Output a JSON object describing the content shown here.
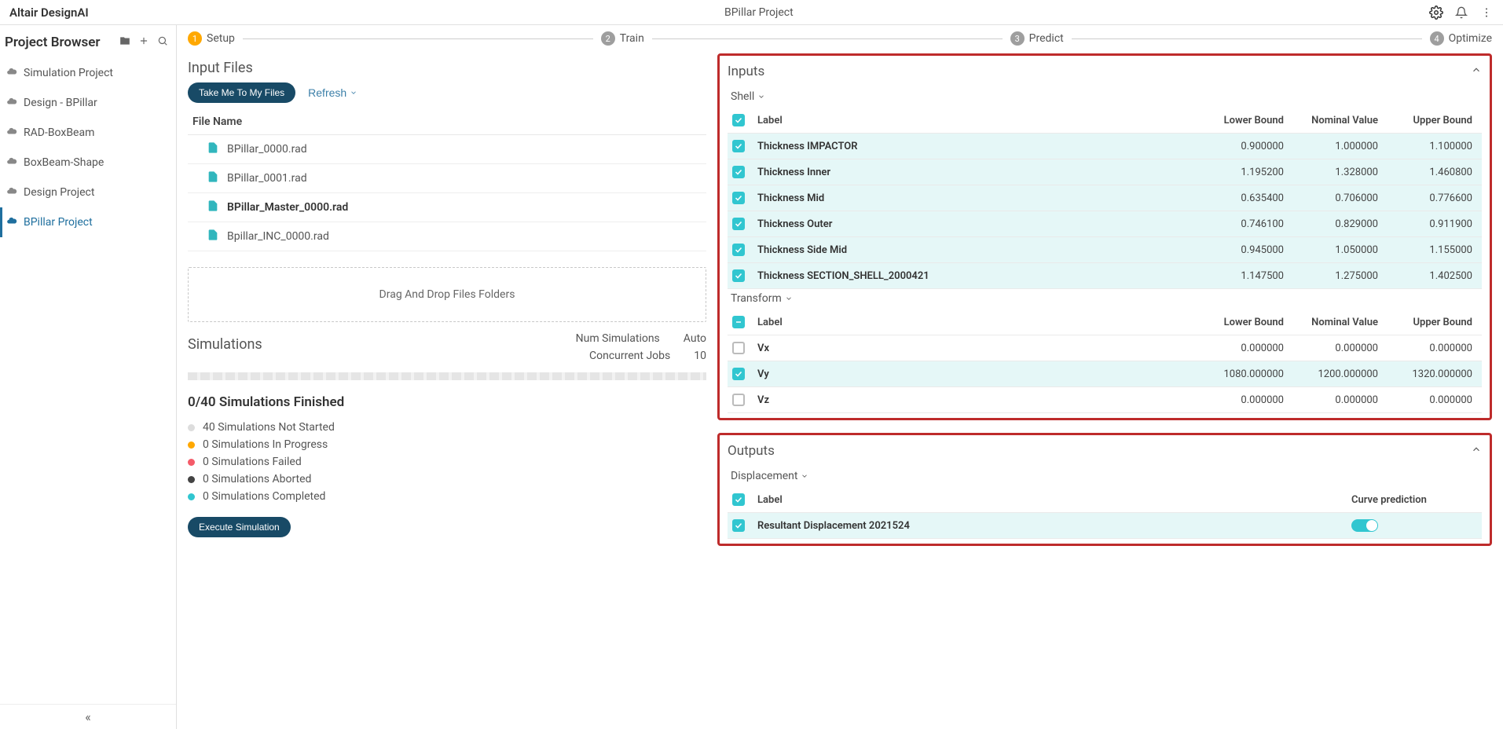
{
  "header": {
    "brand": "Altair DesignAI",
    "project": "BPillar Project"
  },
  "sidebar": {
    "title": "Project Browser",
    "items": [
      {
        "label": "Simulation Project",
        "active": false
      },
      {
        "label": "Design - BPillar",
        "active": false
      },
      {
        "label": "RAD-BoxBeam",
        "active": false
      },
      {
        "label": "BoxBeam-Shape",
        "active": false
      },
      {
        "label": "Design Project",
        "active": false
      },
      {
        "label": "BPillar Project",
        "active": true
      }
    ]
  },
  "stepper": {
    "steps": [
      {
        "num": "1",
        "label": "Setup",
        "active": true
      },
      {
        "num": "2",
        "label": "Train",
        "active": false
      },
      {
        "num": "3",
        "label": "Predict",
        "active": false
      },
      {
        "num": "4",
        "label": "Optimize",
        "active": false
      }
    ]
  },
  "inputFiles": {
    "title": "Input Files",
    "takeMe": "Take Me To My Files",
    "refresh": "Refresh",
    "colHeader": "File Name",
    "files": [
      {
        "name": "BPillar_0000.rad",
        "master": false
      },
      {
        "name": "BPillar_0001.rad",
        "master": false
      },
      {
        "name": "BPillar_Master_0000.rad",
        "master": true
      },
      {
        "name": "Bpillar_INC_0000.rad",
        "master": false
      }
    ],
    "dropzone": "Drag And Drop Files Folders"
  },
  "simulations": {
    "title": "Simulations",
    "numLabel": "Num Simulations",
    "numValue": "Auto",
    "concurrentLabel": "Concurrent Jobs",
    "concurrentValue": "10",
    "status": "0/40 Simulations Finished",
    "legend": [
      {
        "color": "grey",
        "text": "40 Simulations Not Started"
      },
      {
        "color": "orange",
        "text": "0 Simulations In Progress"
      },
      {
        "color": "red",
        "text": "0 Simulations Failed"
      },
      {
        "color": "dark",
        "text": "0 Simulations Aborted"
      },
      {
        "color": "teal",
        "text": "0 Simulations Completed"
      }
    ],
    "execute": "Execute Simulation"
  },
  "inputs": {
    "title": "Inputs",
    "groups": [
      {
        "name": "Shell",
        "headerCheck": "on",
        "cols": {
          "label": "Label",
          "lower": "Lower Bound",
          "nominal": "Nominal Value",
          "upper": "Upper Bound"
        },
        "rows": [
          {
            "checked": true,
            "label": "Thickness IMPACTOR",
            "lower": "0.900000",
            "nominal": "1.000000",
            "upper": "1.100000"
          },
          {
            "checked": true,
            "label": "Thickness Inner",
            "lower": "1.195200",
            "nominal": "1.328000",
            "upper": "1.460800"
          },
          {
            "checked": true,
            "label": "Thickness Mid",
            "lower": "0.635400",
            "nominal": "0.706000",
            "upper": "0.776600"
          },
          {
            "checked": true,
            "label": "Thickness Outer",
            "lower": "0.746100",
            "nominal": "0.829000",
            "upper": "0.911900"
          },
          {
            "checked": true,
            "label": "Thickness Side Mid",
            "lower": "0.945000",
            "nominal": "1.050000",
            "upper": "1.155000"
          },
          {
            "checked": true,
            "label": "Thickness SECTION_SHELL_2000421",
            "lower": "1.147500",
            "nominal": "1.275000",
            "upper": "1.402500"
          }
        ]
      },
      {
        "name": "Transform",
        "headerCheck": "mixed",
        "cols": {
          "label": "Label",
          "lower": "Lower Bound",
          "nominal": "Nominal Value",
          "upper": "Upper Bound"
        },
        "rows": [
          {
            "checked": false,
            "label": "Vx",
            "lower": "0.000000",
            "nominal": "0.000000",
            "upper": "0.000000"
          },
          {
            "checked": true,
            "label": "Vy",
            "lower": "1080.000000",
            "nominal": "1200.000000",
            "upper": "1320.000000"
          },
          {
            "checked": false,
            "label": "Vz",
            "lower": "0.000000",
            "nominal": "0.000000",
            "upper": "0.000000"
          }
        ]
      }
    ]
  },
  "outputs": {
    "title": "Outputs",
    "group": "Displacement",
    "cols": {
      "label": "Label",
      "curve": "Curve prediction"
    },
    "rows": [
      {
        "checked": true,
        "label": "Resultant Displacement 2021524",
        "toggle": true
      }
    ]
  }
}
